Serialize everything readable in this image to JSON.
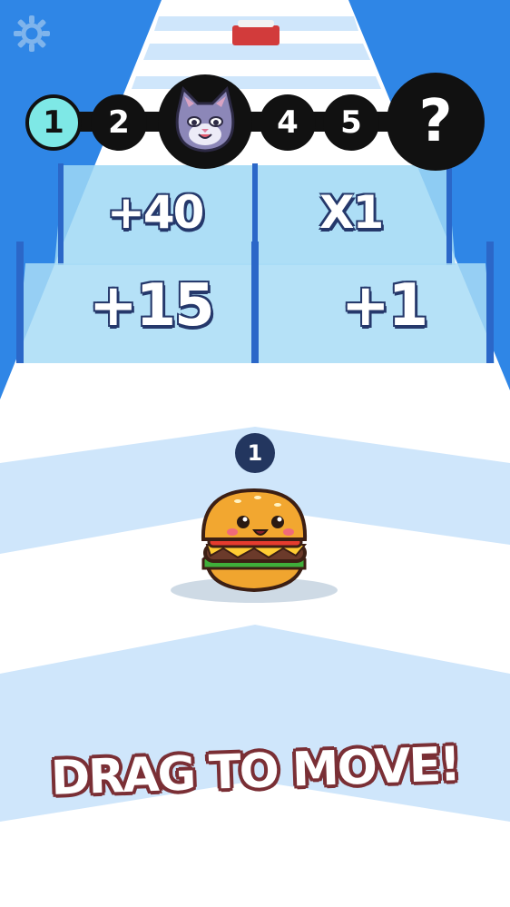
{
  "settings": {
    "icon": "gear-icon"
  },
  "level_progress": {
    "nodes": [
      {
        "label": "1",
        "state": "current"
      },
      {
        "label": "2",
        "state": "locked"
      },
      {
        "label": "",
        "state": "character",
        "icon": "cat-face-icon"
      },
      {
        "label": "4",
        "state": "locked"
      },
      {
        "label": "5",
        "state": "locked"
      },
      {
        "label": "?",
        "state": "mystery"
      }
    ]
  },
  "gates": {
    "far_left": "+40",
    "far_right": "X1",
    "near_left": "+15",
    "near_right": "+1"
  },
  "player": {
    "count": "1",
    "character": "burger-character"
  },
  "hint": "DRAG TO MOVE!",
  "colors": {
    "sky": "#2f86e6",
    "track": "#ffffff",
    "track_stripe": "#cfe6fb",
    "gate_glass": "#9fd8f5",
    "current_node": "#7ee8e6",
    "hint_outline": "#7a2f35"
  }
}
